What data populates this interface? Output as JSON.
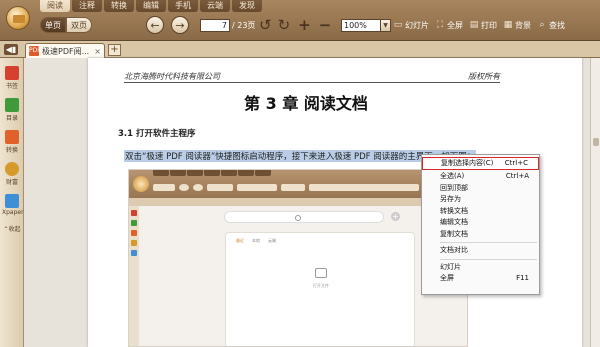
{
  "menu_tabs": [
    "阅读",
    "注释",
    "转换",
    "编辑",
    "手机",
    "云端",
    "发现"
  ],
  "active_menu_tab": 0,
  "toolbar": {
    "single_page": "单页",
    "double_page": "双页",
    "current_page": "7",
    "total_pages": "/ 23页",
    "zoom": "100%",
    "tools": [
      {
        "label": "幻灯片",
        "icon": "slideshow-icon"
      },
      {
        "label": "全屏",
        "icon": "fullscreen-icon"
      },
      {
        "label": "打印",
        "icon": "print-icon"
      },
      {
        "label": "背景",
        "icon": "background-icon"
      },
      {
        "label": "查找",
        "icon": "search-icon"
      }
    ]
  },
  "doc_tab": {
    "title": "极速PDF阅...",
    "close": "×",
    "add": "+"
  },
  "sidebar": [
    {
      "label": "书签",
      "color": "#d6402e"
    },
    {
      "label": "目录",
      "color": "#3f9a3a"
    },
    {
      "label": "转换",
      "color": "#e0612b"
    },
    {
      "label": "财富",
      "color": "#d59a2a"
    },
    {
      "label": "Xpaper",
      "color": "#3e8fd6"
    },
    {
      "label": "收起"
    }
  ],
  "page": {
    "header_left": "北京海腾时代科技有限公司",
    "header_right": "版权所有",
    "chapter_title": "第 3 章 阅读文档",
    "section": "3.1 打开软件主程序",
    "paragraph": "双击“极速 PDF 阅读器”快捷图标启动程序，接下来进入极速 PDF 阅读器的主界面，如下图："
  },
  "embedded": {
    "card_tabs": [
      "最近",
      "本地",
      "云端"
    ],
    "empty_caption": "打开文件",
    "plus": "+"
  },
  "context_menu": [
    {
      "label": "复制选择内容(C)",
      "shortcut": "Ctrl+C",
      "highlight": true
    },
    {
      "label": "全选(A)",
      "shortcut": "Ctrl+A"
    },
    {
      "label": "回到顶部",
      "shortcut": ""
    },
    {
      "label": "另存为",
      "shortcut": ""
    },
    {
      "label": "转换文档",
      "shortcut": ""
    },
    {
      "label": "编辑文档",
      "shortcut": ""
    },
    {
      "label": "复制文档",
      "shortcut": ""
    },
    {
      "sep": true
    },
    {
      "label": "文档对比",
      "shortcut": ""
    },
    {
      "sep": true
    },
    {
      "label": "幻灯片",
      "shortcut": ""
    },
    {
      "label": "全屏",
      "shortcut": "F11"
    }
  ]
}
